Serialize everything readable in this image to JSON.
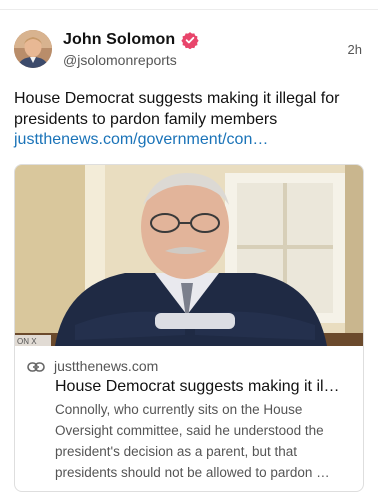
{
  "post": {
    "author_name": "John Solomon",
    "handle": "@jsolomonreports",
    "time": "2h",
    "text": "House Democrat suggests making it illegal for presidents to pardon family members",
    "link_text": "justthenews.com/government/con…"
  },
  "card": {
    "domain": "justthenews.com",
    "title": "House Democrat suggests making it il…",
    "description": "Connolly, who currently sits on the House Oversight committee, said he understood the president's decision as a parent, but that presidents should not be allowed to pardon …",
    "image_tag": "ON X"
  },
  "icons": {
    "verified": "verified-badge-icon",
    "link": "link-icon"
  },
  "colors": {
    "link": "#1a73b8",
    "verified": "#e8456b",
    "muted": "#555555"
  }
}
